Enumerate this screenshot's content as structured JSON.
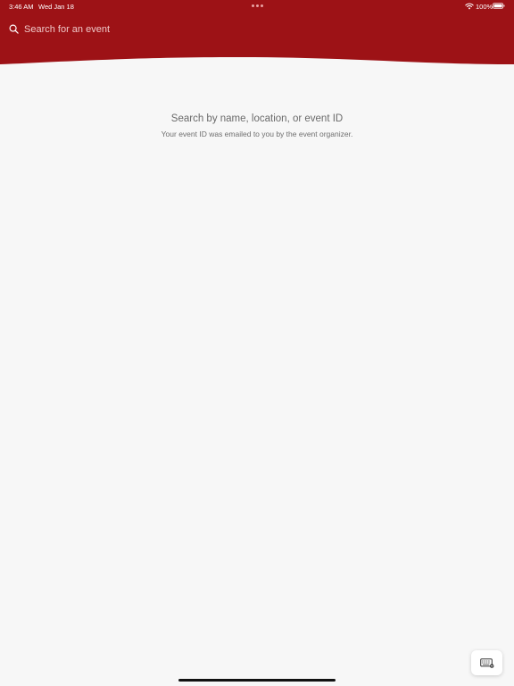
{
  "status_bar": {
    "time": "3:46 AM",
    "date": "Wed Jan 18",
    "battery": "100%"
  },
  "search": {
    "placeholder": "Search for an event",
    "value": ""
  },
  "empty_state": {
    "title": "Search by name, location, or event ID",
    "subtitle": "Your event ID was emailed to you by the event organizer."
  },
  "icons": {
    "search": "search-icon",
    "wifi": "wifi-icon",
    "battery": "battery-icon",
    "keyboard": "keyboard-icon",
    "multitasking": "multitasking-dots-icon"
  },
  "colors": {
    "header_brand": "#9d1216",
    "background": "#f7f7f7",
    "title_text": "#6a6a6a"
  }
}
